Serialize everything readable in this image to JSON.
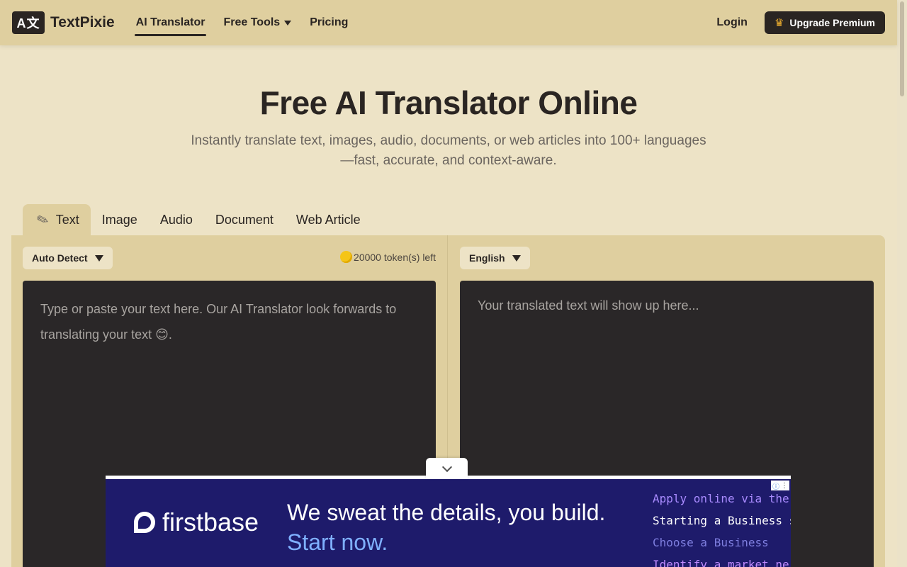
{
  "header": {
    "logo_mark": "A文",
    "logo_text": "TextPixie",
    "nav": [
      {
        "label": "AI Translator",
        "active": true
      },
      {
        "label": "Free Tools",
        "has_dropdown": true
      },
      {
        "label": "Pricing"
      }
    ],
    "login_label": "Login",
    "upgrade_label": "Upgrade Premium",
    "upgrade_icon": "crown-icon"
  },
  "hero": {
    "title": "Free AI Translator Online",
    "subtitle_line1": "Instantly translate text, images, audio, documents, or web articles into 100+ languages",
    "subtitle_line2": "—fast, accurate, and context-aware."
  },
  "tabs": [
    {
      "label": "Text",
      "active": true,
      "icon": "pencil-icon"
    },
    {
      "label": "Image"
    },
    {
      "label": "Audio"
    },
    {
      "label": "Document"
    },
    {
      "label": "Web Article"
    }
  ],
  "translator": {
    "source_language": "Auto Detect",
    "target_language": "English",
    "tokens_left": "20000 token(s) left",
    "source_placeholder": "Type or paste your text here. Our AI Translator look forwards to translating your text 😊.",
    "output_placeholder": "Your translated text will show up here..."
  },
  "ad": {
    "brand": "firstbase",
    "headline": "We sweat the details, you build.",
    "cta": "Start now.",
    "code_lines": [
      {
        "text": "Apply online via the",
        "color": "#a98bff"
      },
      {
        "text": "Starting a Business s",
        "color": "#ffffff"
      },
      {
        "text": "Choose a Business",
        "color": "#7f7fe0"
      },
      {
        "text": "Identify a market ne",
        "color": "#c08bff"
      }
    ]
  },
  "colors": {
    "header_bg": "#dfcf9f",
    "page_bg": "#ede3c6",
    "text_dark": "#2a2522",
    "editor_bg": "#2a2728",
    "ad_bg": "#1e1b6b"
  }
}
